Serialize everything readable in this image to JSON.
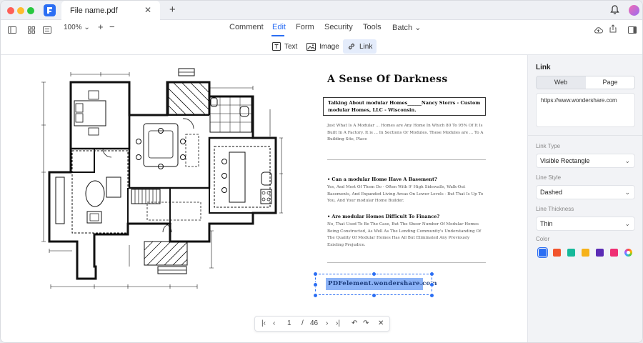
{
  "window": {
    "tab_title": "File name.pdf",
    "tab_close": "✕",
    "new_tab": "+"
  },
  "toolbar": {
    "zoom": "100%",
    "zoom_in": "+",
    "zoom_out": "−",
    "tabs": [
      "Comment",
      "Edit",
      "Form",
      "Security",
      "Tools",
      "Batch"
    ],
    "active_tab": "Edit",
    "batch_chevron": "⌄",
    "sub_tools": [
      "Text",
      "Image",
      "Link"
    ],
    "active_sub_tool": "Link"
  },
  "document": {
    "title": "A Sense Of Darkness",
    "boxed_text": "Talking About modular Homes______Nancy Storrs - Custom modular Homes, LLC - Wisconsin.",
    "intro": "Just What Is A Modular ... Homes are Any Home In Which 80 To 95% Of It Is Built In A Factory. It is ... In Sections Or Modules. These Modules are ... To A Building Site, Place",
    "q1": "• Can a modular Home Have A Basement?",
    "a1": "Yes, And Most Of Them Do - Often With 9' High Sidewalls, Walk-Out Basements, And Expanded Living Areas On Lower Levels - But That Is Up To You, And Your modular Home Builder.",
    "q2": "• Are modular Homes Difficult To Finance?",
    "a2": "No, That Used To Be The Case, But The Sheer Number Of Modular Homes Being Constructed, As Well As The Lending Community's Understanding Of The Quality Of Modular Homes Has All But Eliminated Any Previously Existing Prejudice.",
    "link_text": "PDFelement.wondershare.com"
  },
  "pagenav": {
    "current_page": "1",
    "separator": "/",
    "total_pages": "46"
  },
  "panel": {
    "title": "Link",
    "segments": [
      "Web",
      "Page"
    ],
    "selected_segment": "Page",
    "url": "https://www.wondershare.com",
    "link_type_label": "Link Type",
    "link_type_value": "Visible Rectangle",
    "line_style_label": "Line Style",
    "line_style_value": "Dashed",
    "line_thickness_label": "Line Thickness",
    "line_thickness_value": "Thin",
    "color_label": "Color",
    "colors": [
      "#2b6ef3",
      "#f2542d",
      "#16b99a",
      "#f6b21a",
      "#5b2bb5",
      "#ef2f74"
    ],
    "selected_color": "#2b6ef3",
    "chevron": "⌄"
  }
}
